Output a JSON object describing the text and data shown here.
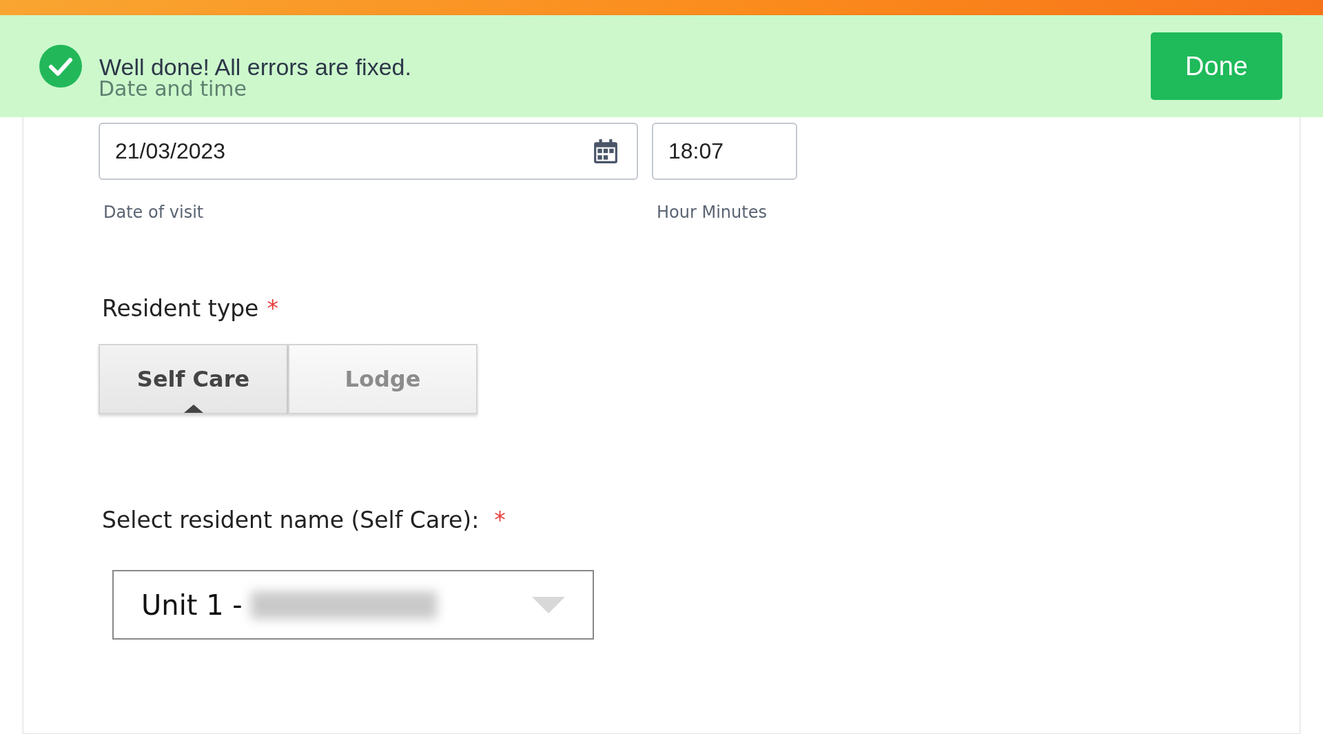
{
  "banner": {
    "message": "Well done! All errors are fixed.",
    "button": "Done"
  },
  "section_title": "Date and time",
  "date_field": {
    "value": "21/03/2023",
    "caption": "Date of visit"
  },
  "time_field": {
    "value": "18:07",
    "caption": "Hour Minutes"
  },
  "resident_type": {
    "label": "Resident type",
    "required_mark": "*",
    "options": [
      {
        "label": "Self Care",
        "selected": true
      },
      {
        "label": "Lodge",
        "selected": false
      }
    ]
  },
  "resident_name": {
    "label": "Select resident name (Self Care):",
    "required_mark": "*",
    "value": "Unit 1 -"
  }
}
